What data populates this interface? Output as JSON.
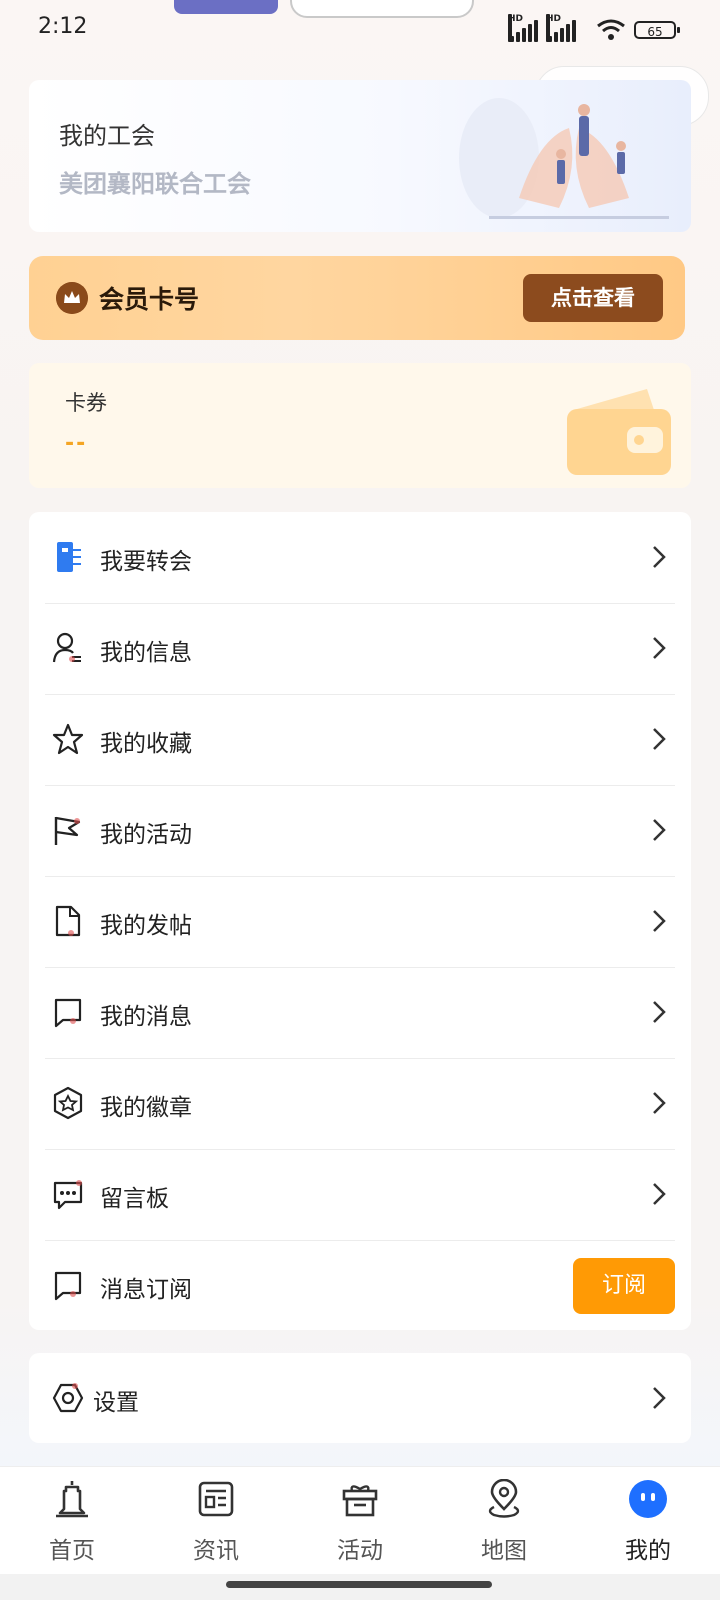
{
  "status_bar": {
    "time": "2:12",
    "battery": "65"
  },
  "union": {
    "title": "我的工会",
    "name": "美团襄阳联合工会"
  },
  "member": {
    "label": "会员卡号",
    "button": "点击查看"
  },
  "coupon": {
    "title": "卡券",
    "value": "--"
  },
  "menu": {
    "items": [
      {
        "label": "我要转会",
        "icon": "transfer-door-icon"
      },
      {
        "label": "我的信息",
        "icon": "user-info-icon"
      },
      {
        "label": "我的收藏",
        "icon": "star-icon"
      },
      {
        "label": "我的活动",
        "icon": "flag-icon"
      },
      {
        "label": "我的发帖",
        "icon": "document-icon"
      },
      {
        "label": "我的消息",
        "icon": "message-icon"
      },
      {
        "label": "我的徽章",
        "icon": "badge-icon"
      },
      {
        "label": "留言板",
        "icon": "comment-icon"
      },
      {
        "label": "消息订阅",
        "icon": "subscribe-message-icon",
        "action": "订阅"
      }
    ]
  },
  "settings": {
    "label": "设置",
    "icon": "settings-icon"
  },
  "tabbar": {
    "tabs": [
      {
        "label": "首页",
        "icon": "home-tower-icon"
      },
      {
        "label": "资讯",
        "icon": "news-icon"
      },
      {
        "label": "活动",
        "icon": "gift-icon"
      },
      {
        "label": "地图",
        "icon": "map-pin-icon"
      },
      {
        "label": "我的",
        "icon": "profile-face-icon",
        "active": true
      }
    ]
  },
  "colors": {
    "accent_orange": "#ff9a05",
    "member_button": "#8c4b1e",
    "active_tab": "#1e6fff",
    "coupon_value": "#f4a523"
  }
}
